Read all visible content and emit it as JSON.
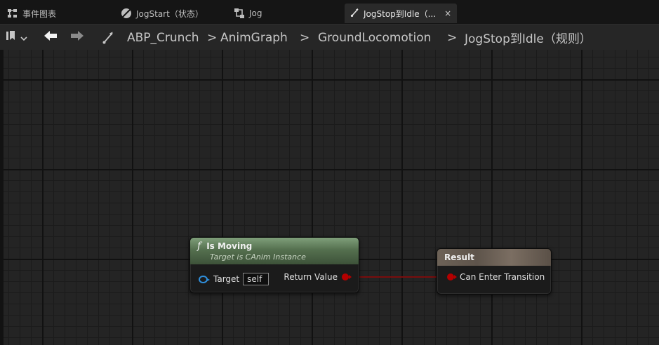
{
  "tabs": [
    {
      "label": "事件图表",
      "icon": "event-graph-icon",
      "active": false
    },
    {
      "label": "JogStart（状态）",
      "icon": "state-icon",
      "active": false
    },
    {
      "label": "Jog",
      "icon": "state-machine-icon",
      "active": false
    },
    {
      "label": "JogStop到Idle（...",
      "icon": "transition-icon",
      "active": true,
      "close": "×"
    }
  ],
  "toolbar": {
    "bookmark_icon": "bookmark-icon",
    "back_icon": "back-arrow-icon",
    "forward_icon": "forward-arrow-icon",
    "rule_icon": "transition-rule-icon"
  },
  "breadcrumb": {
    "items": [
      "ABP_Crunch",
      "AnimGraph",
      "GroundLocomotion",
      "JogStop到Idle（规则）"
    ],
    "separator": ">"
  },
  "nodes": {
    "is_moving": {
      "title": "Is Moving",
      "subtitle": "Target is CAnim Instance",
      "icon": "function-icon",
      "input_label": "Target",
      "input_value": "self",
      "output_label": "Return Value",
      "header_color": "#55704f"
    },
    "result": {
      "title": "Result",
      "input_label": "Can Enter Transition",
      "header_color": "#6d6257"
    }
  },
  "colors": {
    "canvas": "#242424",
    "bool_pin": "#b40000",
    "exec_pin": "#2f8fdc",
    "wire": "#7a0d0d"
  }
}
